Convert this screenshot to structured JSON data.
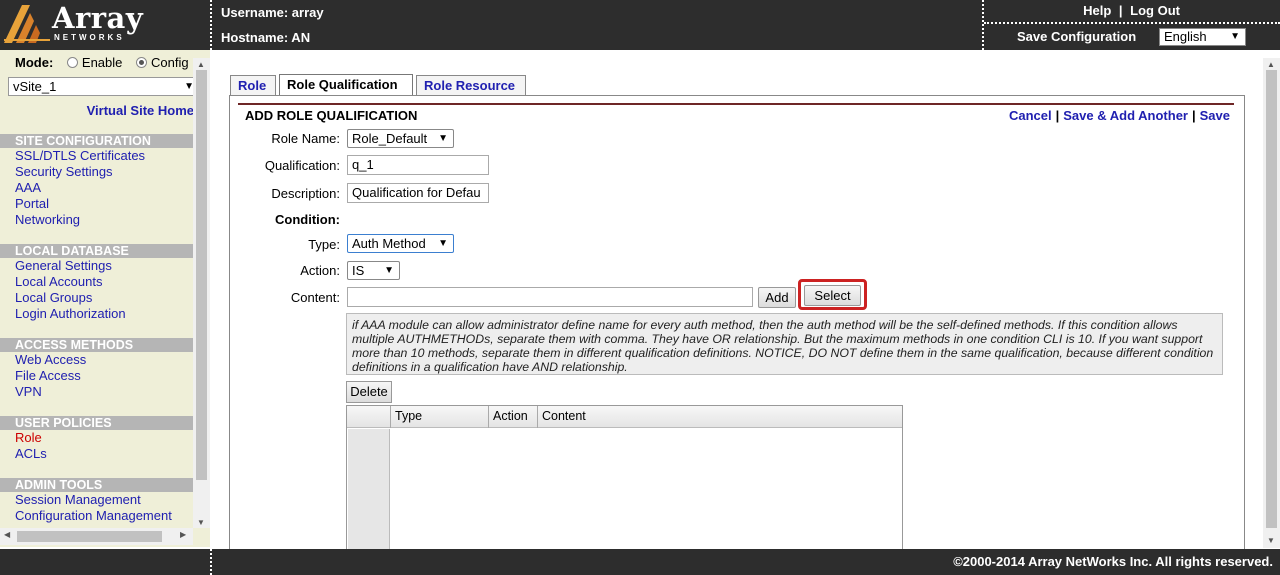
{
  "header": {
    "logo_text": "Array",
    "logo_sub": "NETWORKS",
    "username_label": "Username: array",
    "hostname_label": "Hostname: AN",
    "help": "Help",
    "logout": "Log Out",
    "link_sep": "|",
    "save_configuration": "Save Configuration",
    "language": "English"
  },
  "sidebar": {
    "mode_label": "Mode:",
    "mode_enable": "Enable",
    "mode_config": "Config",
    "vsite": "vSite_1",
    "virtual_site_home": "Virtual Site Home",
    "sections": [
      {
        "title": "SITE CONFIGURATION",
        "items": [
          "SSL/DTLS Certificates",
          "Security Settings",
          "AAA",
          "Portal",
          "Networking"
        ]
      },
      {
        "title": "LOCAL DATABASE",
        "items": [
          "General Settings",
          "Local Accounts",
          "Local Groups",
          "Login Authorization"
        ]
      },
      {
        "title": "ACCESS METHODS",
        "items": [
          "Web Access",
          "File Access",
          "VPN"
        ]
      },
      {
        "title": "USER POLICIES",
        "items": [
          "Role",
          "ACLs"
        ]
      },
      {
        "title": "ADMIN TOOLS",
        "items": [
          "Session Management",
          "Configuration Management"
        ]
      }
    ]
  },
  "tabs": [
    {
      "label": "Role"
    },
    {
      "label": "Role Qualification"
    },
    {
      "label": "Role Resource"
    }
  ],
  "panel": {
    "title": "ADD ROLE QUALIFICATION",
    "cancel": "Cancel",
    "save_add_another": "Save & Add Another",
    "save": "Save",
    "sep": "|"
  },
  "form": {
    "role_name_label": "Role Name:",
    "role_name_value": "Role_Default",
    "qualification_label": "Qualification:",
    "qualification_value": "q_1",
    "description_label": "Description:",
    "description_value": "Qualification for Defau",
    "condition_label": "Condition:",
    "type_label": "Type:",
    "type_value": "Auth Method",
    "action_label": "Action:",
    "action_value": "IS",
    "content_label": "Content:",
    "content_value": "",
    "add_button": "Add",
    "select_button": "Select",
    "help_text": "if AAA module can allow administrator define name for every auth method, then the auth method will be the self-defined methods. If this condition allows multiple AUTHMETHODs, separate them with comma. They have OR relationship. But the maximum methods in one condition CLI is 10. If you want support more than 10 methods, separate them in different qualification definitions. NOTICE, DO NOT define them in the same qualification, because different condition definitions in a qualification have AND relationship.",
    "delete_button": "Delete"
  },
  "grid": {
    "columns": [
      "Type",
      "Action",
      "Content"
    ],
    "rows": []
  },
  "footer": {
    "copyright": "©2000-2014 Array NetWorks Inc. All rights reserved."
  },
  "icons": {
    "dropdown": "chevron-down-icon",
    "logo": "array-logo-icon"
  }
}
